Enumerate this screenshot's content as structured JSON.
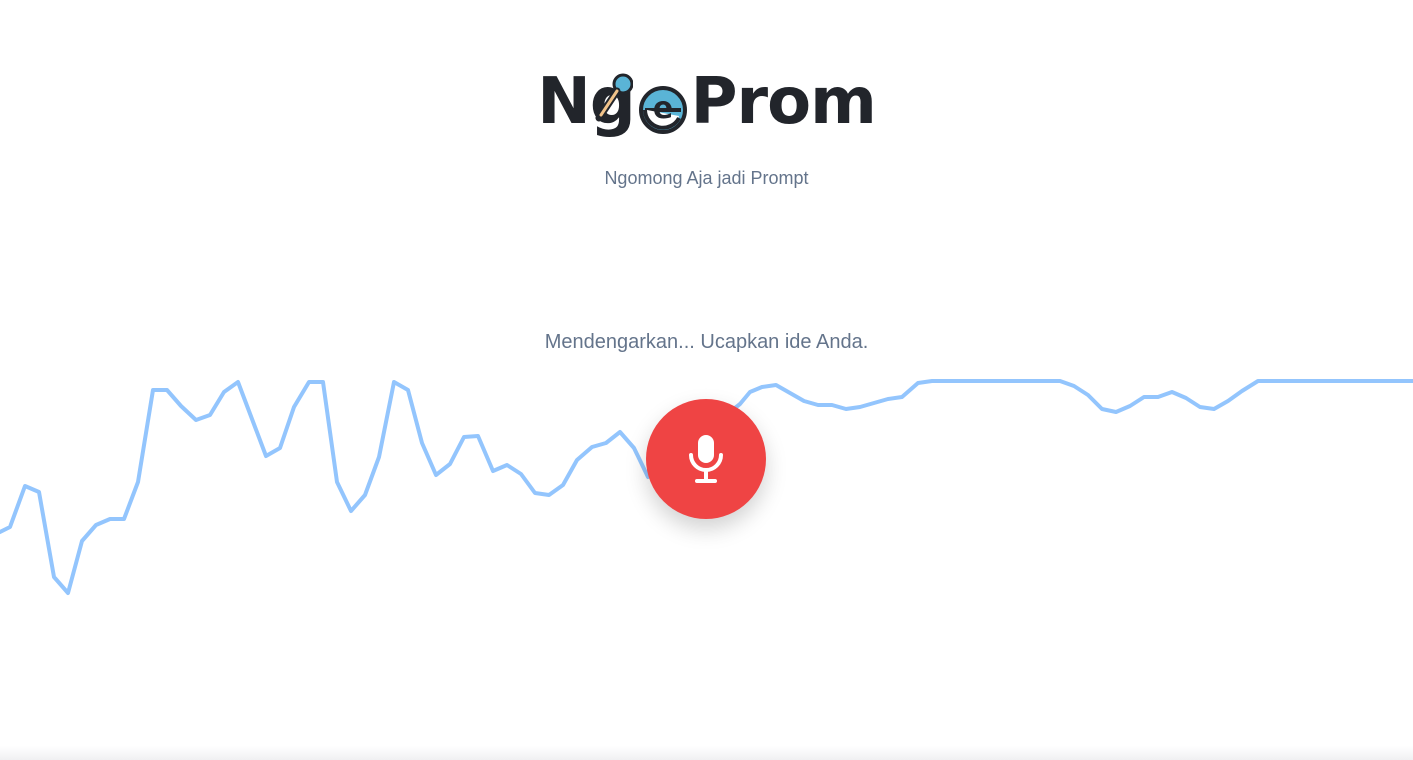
{
  "brand": {
    "logo_prefix": "Ng",
    "logo_middle": "e",
    "logo_suffix": "Prom",
    "tagline": "Ngomong Aja jadi Prompt"
  },
  "status": {
    "message": "Mendengarkan... Ucapkan ide Anda."
  },
  "mic_button": {
    "icon": "microphone-icon",
    "state": "recording"
  },
  "waveform": {
    "color": "#93c5fd",
    "levels": [
      0.63,
      0.6,
      0.52,
      0.57,
      0.75,
      0.77,
      0.7,
      0.7,
      0.66,
      0.66,
      0.6,
      0.54,
      0.57,
      0.68,
      0.7,
      0.75,
      0.98,
      0.98,
      0.96,
      0.9,
      0.95,
      0.88,
      0.98,
      0.98,
      0.93,
      0.99,
      0.96,
      0.73,
      0.64,
      0.59,
      0.79,
      0.73,
      0.63,
      0.64,
      0.71,
      0.75,
      0.98,
      0.98,
      0.98,
      0.95,
      0.95,
      0.91,
      0.91,
      0.9,
      0.86,
      0.8,
      0.86,
      0.97,
      0.99,
      0.95,
      0.86,
      0.75,
      0.73,
      0.78,
      0.85,
      0.83,
      0.8,
      0.78,
      0.73,
      0.77,
      0.85,
      0.89,
      0.96,
      0.99,
      0.98,
      0.95,
      0.87,
      0.82,
      0.78,
      0.77,
      0.75,
      0.7,
      0.62,
      0.6,
      0.61,
      0.62,
      0.6,
      0.62,
      0.73,
      0.81,
      0.87,
      0.87,
      0.93,
      0.99,
      0.97,
      0.96,
      0.95,
      0.95,
      0.98,
      0.97,
      0.96,
      0.96,
      1.0,
      1.0,
      1.0,
      1.0,
      1.0,
      1.0,
      1.0,
      1.0,
      1.0,
      1.0,
      1.0,
      0.99,
      0.98,
      0.92,
      0.9,
      0.93,
      0.96,
      0.96,
      0.99,
      0.96,
      0.92,
      0.91,
      0.95,
      1.0,
      1.0,
      1.0,
      1.0,
      1.0,
      1.0,
      1.0,
      1.0,
      1.0,
      1.0,
      1.0,
      1.0
    ]
  }
}
